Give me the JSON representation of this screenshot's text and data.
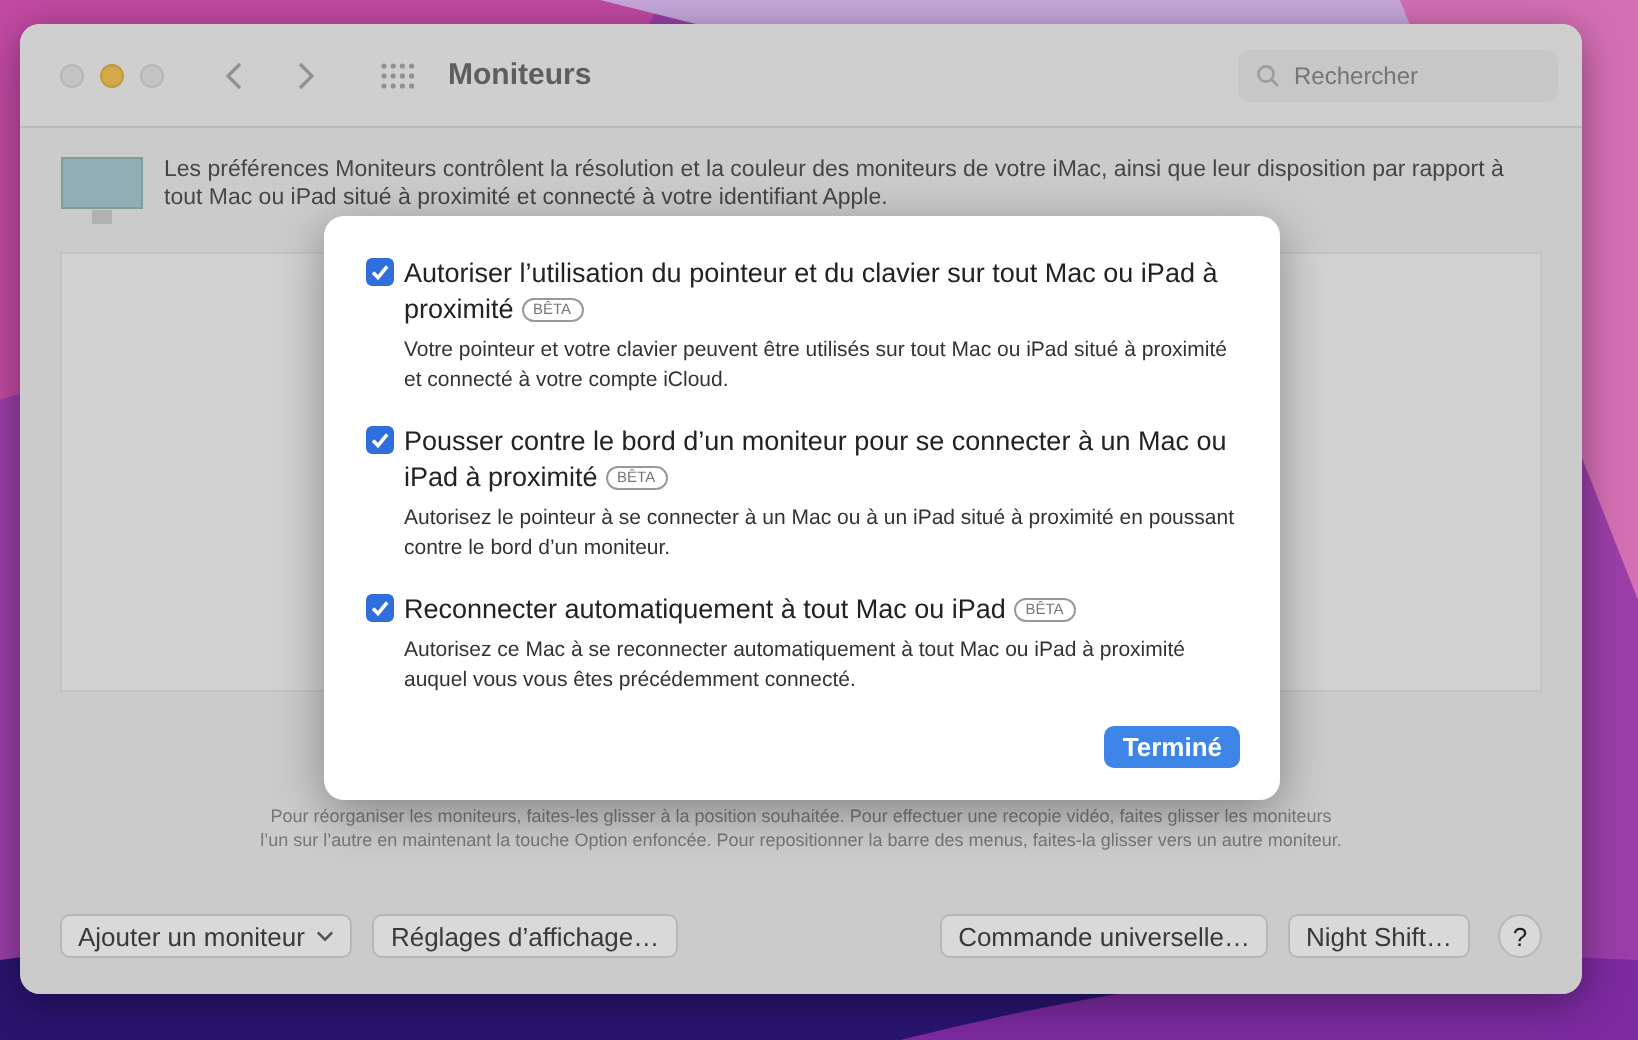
{
  "window": {
    "title": "Moniteurs",
    "search": {
      "placeholder": "Rechercher"
    }
  },
  "intro": "Les préférences Moniteurs contrôlent la résolution et la couleur des moniteurs de votre iMac, ainsi que leur disposition par rapport à tout Mac ou iPad situé à proximité et connecté à votre identifiant Apple.",
  "hint": "Pour réorganiser les moniteurs, faites-les glisser à la position souhaitée. Pour effectuer une recopie vidéo, faites glisser les moniteurs l’un sur l’autre en maintenant la touche Option enfoncée. Pour repositionner la barre des menus, faites-la glisser vers un autre moniteur.",
  "buttons": [
    {
      "label": "Ajouter un moniteur",
      "kind": "menu"
    },
    {
      "label": "Réglages d’affichage…",
      "kind": "plain"
    },
    {
      "label": "Commande universelle…",
      "kind": "plain"
    },
    {
      "label": "Night Shift…",
      "kind": "plain"
    },
    {
      "label": "?",
      "kind": "help"
    }
  ],
  "sheet": {
    "options": [
      {
        "label": "Autoriser l’utilisation du pointeur et du clavier sur tout Mac ou iPad à proximité",
        "badge": "BÊTA",
        "checked": true,
        "description": "Votre pointeur et votre clavier peuvent être utilisés sur tout Mac ou iPad situé à proximité et connecté à votre compte iCloud."
      },
      {
        "label": "Pousser contre le bord d’un moniteur pour se connecter à un Mac ou iPad à proximité",
        "badge": "BÊTA",
        "checked": true,
        "description": "Autorisez le pointeur à se connecter à un Mac ou à un iPad situé à proximité en poussant contre le bord d’un moniteur."
      },
      {
        "label": "Reconnecter automatiquement à tout Mac ou iPad",
        "badge": "BÊTA",
        "checked": true,
        "description": "Autorisez ce Mac à se reconnecter automatiquement à tout Mac ou iPad à proximité auquel vous vous êtes précédemment connecté."
      }
    ],
    "done": "Terminé"
  }
}
